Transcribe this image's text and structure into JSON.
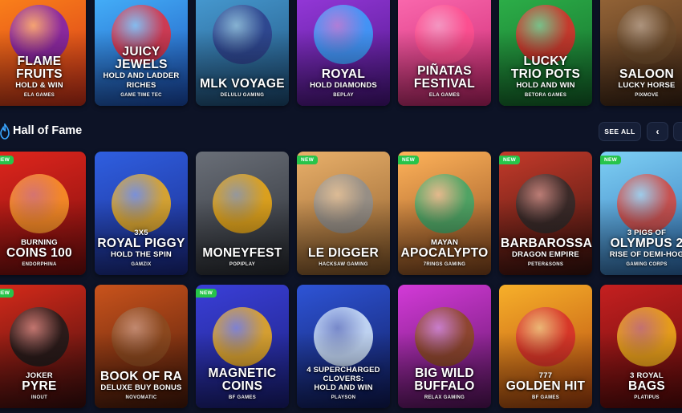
{
  "section": {
    "title": "Hall of Fame",
    "see_all": "SEE ALL",
    "prev": "‹",
    "next": "›"
  },
  "badge_new": "NEW",
  "rows": [
    {
      "games": [
        {
          "pre": "",
          "title": "FLAME\nFRUITS",
          "sub": "HOLD & WIN",
          "provider": "ELA GAMES",
          "bg": [
            "#ff8a1a",
            "#d2311a"
          ],
          "blob": "#7a1fb5",
          "new": false
        },
        {
          "pre": "",
          "title": "JUICY\nJEWELS",
          "sub": "HOLD AND LADDER\nRICHES",
          "provider": "GAME TIME TEC",
          "bg": [
            "#48b8ff",
            "#1b4fb8"
          ],
          "blob": "#e62d3b",
          "new": false
        },
        {
          "pre": "",
          "title": "MLK VOYAGE",
          "sub": "",
          "provider": "DELULU GAMING",
          "bg": [
            "#4aa0d8",
            "#1e4f7a"
          ],
          "blob": "#2d3e8a",
          "new": false
        },
        {
          "pre": "",
          "title": "ROYAL",
          "sub": "HOLD DIAMONDS",
          "provider": "BEPLAY",
          "bg": [
            "#9b3be0",
            "#4b1585"
          ],
          "blob": "#3aa5ff",
          "new": false
        },
        {
          "pre": "",
          "title": "PIÑATAS\nFESTIVAL",
          "sub": "",
          "provider": "ELA GAMES",
          "bg": [
            "#ff6fb4",
            "#c9256e"
          ],
          "blob": "#ff4f8f",
          "new": false
        },
        {
          "pre": "",
          "title": "LUCKY\nTRIO POTS",
          "sub": "HOLD AND WIN",
          "provider": "BETORA GAMES",
          "bg": [
            "#2fb54b",
            "#136a2b"
          ],
          "blob": "#e02a2a",
          "new": false
        },
        {
          "pre": "",
          "title": "SALOON",
          "sub": "LUCKY HORSE",
          "provider": "PIXMOVE",
          "bg": [
            "#9c6a3a",
            "#3d2414"
          ],
          "blob": "#6b4a2a",
          "new": false
        }
      ]
    },
    {
      "games": [
        {
          "pre": "BURNING",
          "title": "COINS 100",
          "sub": "",
          "provider": "ENDORPHINA",
          "bg": [
            "#e0261d",
            "#7a0d0d"
          ],
          "blob": "#ff9a2a",
          "new": true
        },
        {
          "pre": "3X5",
          "title": "ROYAL PIGGY",
          "sub": "HOLD THE SPIN",
          "provider": "GAMZIX",
          "bg": [
            "#2f5fe0",
            "#1b2a8a"
          ],
          "blob": "#f2b21c",
          "new": false
        },
        {
          "pre": "",
          "title": "MONEYFEST",
          "sub": "",
          "provider": "POPIPLAY",
          "bg": [
            "#6a6f78",
            "#2a2d33"
          ],
          "blob": "#f2ad14",
          "new": false
        },
        {
          "pre": "",
          "title": "LE DIGGER",
          "sub": "",
          "provider": "HACKSAW GAMING",
          "bg": [
            "#e9b06a",
            "#8a5a2a"
          ],
          "blob": "#8f8f8f",
          "new": true
        },
        {
          "pre": "MAYAN",
          "title": "APOCALYPTO",
          "sub": "",
          "provider": "7RINGS GAMING",
          "bg": [
            "#ffb35a",
            "#8b4a1f"
          ],
          "blob": "#3aa86a",
          "new": true
        },
        {
          "pre": "",
          "title": "BARBAROSSA",
          "sub": "DRAGON EMPIRE",
          "provider": "PETER&SONS",
          "bg": [
            "#c43a2a",
            "#3a120d"
          ],
          "blob": "#2d2a2a",
          "new": true
        },
        {
          "pre": "3 PIGS OF",
          "title": "OLYMPUS 2",
          "sub": "RISE OF DEMI-HOG",
          "provider": "GAMING CORPS",
          "bg": [
            "#7ed0f5",
            "#2f6fb4"
          ],
          "blob": "#d9443a",
          "new": true
        }
      ]
    },
    {
      "games": [
        {
          "pre": "JOKER",
          "title": "PYRE",
          "sub": "",
          "provider": "INOUT",
          "bg": [
            "#d62a1a",
            "#3b0d0d"
          ],
          "blob": "#1a1a1a",
          "new": true
        },
        {
          "pre": "",
          "title": "BOOK OF RA",
          "sub": "DELUXE BUY BONUS",
          "provider": "NOVOMATIC",
          "bg": [
            "#c9531c",
            "#4a1a0a"
          ],
          "blob": "#8a4a20",
          "new": false
        },
        {
          "pre": "",
          "title": "MAGNETIC\nCOINS",
          "sub": "",
          "provider": "BF GAMES",
          "bg": [
            "#3a3fd8",
            "#1a1f7a"
          ],
          "blob": "#f2b21c",
          "new": true
        },
        {
          "pre": "4 SUPERCHARGED\nCLOVERS:",
          "title": "",
          "sub": "HOLD AND WIN",
          "provider": "PLAYSON",
          "bg": [
            "#2e54d6",
            "#0f1b5a"
          ],
          "blob": "#d9ecff",
          "new": false
        },
        {
          "pre": "",
          "title": "BIG WILD\nBUFFALO",
          "sub": "",
          "provider": "RELAX GAMING",
          "bg": [
            "#d33ad8",
            "#5a1560"
          ],
          "blob": "#8a4a1c",
          "new": false
        },
        {
          "pre": "777",
          "title": "GOLDEN HIT",
          "sub": "",
          "provider": "BF GAMES",
          "bg": [
            "#f7b02a",
            "#b4450e"
          ],
          "blob": "#d62a2a",
          "new": false
        },
        {
          "pre": "3 ROYAL",
          "title": "BAGS",
          "sub": "",
          "provider": "PLATIPUS",
          "bg": [
            "#c52020",
            "#5a0a0a"
          ],
          "blob": "#f2b21c",
          "new": false
        }
      ]
    }
  ]
}
